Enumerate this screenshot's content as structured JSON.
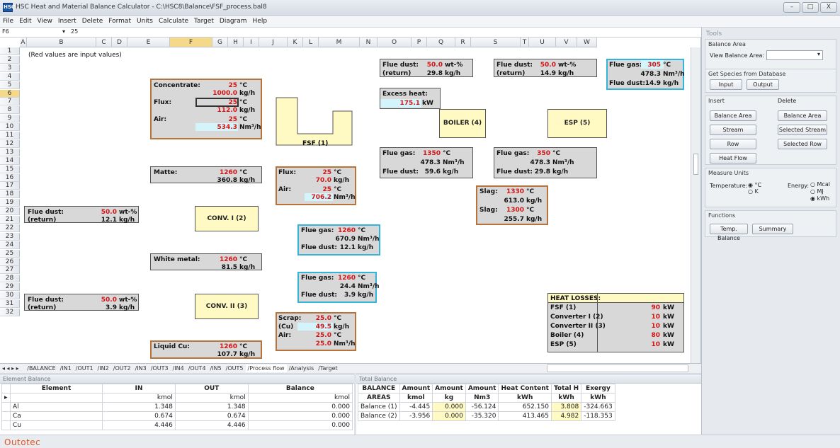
{
  "window": {
    "title": "HSC Heat and Material Balance Calculator - C:\\HSC8\\Balance\\FSF_process.bal8",
    "icon": "app-icon",
    "buttons": [
      "–",
      "□",
      "X"
    ]
  },
  "menu": [
    "File",
    "Edit",
    "View",
    "Insert",
    "Delete",
    "Format",
    "Units",
    "Calculate",
    "Target",
    "Diagram",
    "Help"
  ],
  "formula": {
    "cell": "F6",
    "value": "25"
  },
  "columns": [
    "A",
    "B",
    "C",
    "D",
    "E",
    "F",
    "G",
    "H",
    "I",
    "J",
    "K",
    "L",
    "M",
    "N",
    "O",
    "P",
    "Q",
    "R",
    "S",
    "T",
    "U",
    "V",
    "W"
  ],
  "rows": [
    "1",
    "2",
    "3",
    "4",
    "5",
    "6",
    "7",
    "8",
    "9",
    "10",
    "11",
    "12",
    "13",
    "14",
    "15",
    "16",
    "17",
    "18",
    "19",
    "20",
    "21",
    "22",
    "23",
    "24",
    "25",
    "26",
    "27",
    "28",
    "29",
    "30",
    "31",
    "32"
  ],
  "note": "(Red values are input values)",
  "units_blocks": {
    "fsf": "FSF (1)",
    "conv1": "CONV. I (2)",
    "conv2": "CONV. II (3)",
    "boiler": "BOILER (4)",
    "esp": "ESP (5)"
  },
  "feed": {
    "conc_label": "Concentrate:",
    "conc_t": "25",
    "conc_tu": "°C",
    "conc_m": "1000.0",
    "conc_mu": "kg/h",
    "flux_label": "Flux:",
    "flux_t": "25",
    "flux_tu": "°C",
    "flux_m": "112.0",
    "flux_mu": "kg/h",
    "air_label": "Air:",
    "air_t": "25",
    "air_tu": "°C",
    "air_v": "534.3",
    "air_vu": "Nm³/h"
  },
  "matte": {
    "label": "Matte:",
    "t": "1260",
    "tu": "°C",
    "m": "360.8",
    "mu": "kg/h"
  },
  "white": {
    "label": "White metal:",
    "t": "1260",
    "tu": "°C",
    "m": "81.5",
    "mu": "kg/h"
  },
  "liquidcu": {
    "label": "Liquid Cu:",
    "t": "1260",
    "tu": "°C",
    "m": "107.7",
    "mu": "kg/h"
  },
  "fd1": {
    "label": "Flue dust:",
    "v": "50.0",
    "vu": "wt-%",
    "label2": "(return)",
    "m": "12.1",
    "mu": "kg/h"
  },
  "fd2": {
    "label": "Flue dust:",
    "v": "50.0",
    "vu": "wt-%",
    "label2": "(return)",
    "m": "3.9",
    "mu": "kg/h"
  },
  "flux2": {
    "flux_label": "Flux:",
    "flux_t": "25",
    "flux_tu": "°C",
    "flux_m": "70.0",
    "flux_mu": "kg/h",
    "air_label": "Air:",
    "air_t": "25",
    "air_tu": "°C",
    "air_v": "706.2",
    "air_vu": "Nm³/h"
  },
  "fg1": {
    "label": "Flue gas:",
    "t": "1260",
    "tu": "°C",
    "v": "670.9",
    "vu": "Nm³/h",
    "label2": "Flue dust:",
    "m": "12.1",
    "mu": "kg/h"
  },
  "fg2": {
    "label": "Flue gas:",
    "t": "1260",
    "tu": "°C",
    "v": "24.4",
    "vu": "Nm³/h",
    "label2": "Flue dust:",
    "m": "3.9",
    "mu": "kg/h"
  },
  "scrap": {
    "label": "Scrap:",
    "t": "25.0",
    "tu": "°C",
    "label2": "(Cu)",
    "m": "49.5",
    "mu": "kg/h",
    "air_label": "Air:",
    "air_t": "25.0",
    "air_tu": "°C",
    "air_v": "25.0",
    "air_vu": "Nm³/h"
  },
  "fdret1": {
    "label": "Flue dust:",
    "v": "50.0",
    "vu": "wt-%",
    "label2": "(return)",
    "m": "29.8",
    "mu": "kg/h"
  },
  "fdret2": {
    "label": "Flue dust:",
    "v": "50.0",
    "vu": "wt-%",
    "label2": "(return)",
    "m": "14.9",
    "mu": "kg/h"
  },
  "fgout": {
    "label": "Flue gas:",
    "t": "305",
    "tu": "°C",
    "v": "478.3",
    "vu": "Nm³/h",
    "label2": "Flue dust:",
    "m": "14.9",
    "mu": "kg/h"
  },
  "excess": {
    "label": "Excess heat:",
    "v": "175.1",
    "vu": "kW"
  },
  "fgboil": {
    "label": "Flue gas:",
    "t": "1350",
    "tu": "°C",
    "v": "478.3",
    "vu": "Nm³/h",
    "label2": "Flue dust:",
    "m": "59.6",
    "mu": "kg/h"
  },
  "fgesp": {
    "label": "Flue gas:",
    "t": "350",
    "tu": "°C",
    "v": "478.3",
    "vu": "Nm³/h",
    "label2": "Flue dust:",
    "m": "29.8",
    "mu": "kg/h"
  },
  "slag": {
    "label": "Slag:",
    "t": "1330",
    "tu": "°C",
    "m": "613.0",
    "mu": "kg/h",
    "label2": "Slag:",
    "t2": "1300",
    "m2": "255.7"
  },
  "heatloss": {
    "title": "HEAT LOSSES:",
    "rows": [
      {
        "n": "FSF (1)",
        "v": "90",
        "u": "kW"
      },
      {
        "n": "Converter I (2)",
        "v": "10",
        "u": "kW"
      },
      {
        "n": "Converter II (3)",
        "v": "10",
        "u": "kW"
      },
      {
        "n": "Boiler (4)",
        "v": "80",
        "u": "kW"
      },
      {
        "n": "ESP (5)",
        "v": "10",
        "u": "kW"
      }
    ]
  },
  "tabs": [
    "BALANCE",
    "IN1",
    "OUT1",
    "IN2",
    "OUT2",
    "IN3",
    "OUT3",
    "IN4",
    "OUT4",
    "IN5",
    "OUT5",
    "Process flow",
    "Analysis",
    "Target"
  ],
  "tabs_active": "Process flow",
  "tools": {
    "header": "Tools",
    "balance_area": "Balance Area",
    "view_balance_area": "View Balance Area:",
    "get_species": "Get Species from Database",
    "input": "Input",
    "output": "Output",
    "insert": "Insert",
    "delete": "Delete",
    "ins_balance": "Balance Area",
    "ins_stream": "Stream",
    "ins_row": "Row",
    "ins_heat": "Heat Flow",
    "del_balance": "Balance Area",
    "del_stream": "Selected Stream",
    "del_row": "Selected Row",
    "measure": "Measure Units",
    "temperature": "Temperature:",
    "t_c": "°C",
    "t_k": "K",
    "energy": "Energy:",
    "e_mcal": "Mcal",
    "e_mj": "MJ",
    "e_kwh": "kWh",
    "functions": "Functions",
    "temp_balance": "Temp. Balance",
    "summary": "Summary"
  },
  "element_balance": {
    "title": "Element Balance",
    "headers": [
      "Element",
      "IN",
      "OUT",
      "Balance"
    ],
    "units": [
      "",
      "kmol",
      "kmol",
      "kmol"
    ],
    "rows": [
      [
        "Al",
        "1.348",
        "1.348",
        "0.000"
      ],
      [
        "Ca",
        "0.674",
        "0.674",
        "0.000"
      ],
      [
        "Cu",
        "4.446",
        "4.446",
        "0.000"
      ]
    ]
  },
  "total_balance": {
    "title": "Total Balance",
    "headers": [
      "BALANCE",
      "Amount",
      "Amount",
      "Amount",
      "Heat Content",
      "Total H",
      "Exergy"
    ],
    "units": [
      "AREAS",
      "kmol",
      "kg",
      "Nm3",
      "kWh",
      "kWh",
      "kWh"
    ],
    "rows": [
      [
        "Balance (1)",
        "-4.445",
        "0.000",
        "-56.124",
        "652.150",
        "3.808",
        "-324.663"
      ],
      [
        "Balance (2)",
        "-3.956",
        "0.000",
        "-35.320",
        "413.465",
        "4.982",
        "-118.353"
      ]
    ]
  },
  "brand": "Outotec",
  "colors": {
    "input_red": "#d41515",
    "orange_border": "#b8733b",
    "cyan_border": "#33b4d8",
    "unit_yellow": "#fff9c4",
    "brand": "#e0531c"
  }
}
